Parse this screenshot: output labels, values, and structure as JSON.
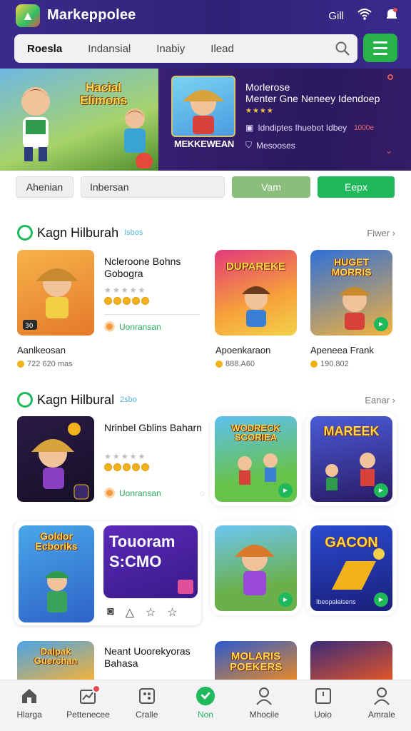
{
  "app": {
    "title": "Markeppolee",
    "logo_icon": "app-logo",
    "accent_color": "#1fb85a",
    "header_color": "#2f2277"
  },
  "status": {
    "signal_label": "Gill",
    "icons": [
      "signal-icon",
      "wifi-icon",
      "notification-icon"
    ]
  },
  "search": {
    "tabs": [
      "Roesla",
      "Indansial",
      "Inabiy",
      "Ilead"
    ],
    "icon": "search-icon",
    "menu_icon": "hamburger-icon"
  },
  "banner": {
    "headline": "Hacial Elimons",
    "art_label": "MEKKEWEAN",
    "title_line1": "Morlerose",
    "title_line2": "Menter Gne Neneey Idendoep",
    "rating": "★★★★",
    "line1": "Idndiptes Ihuebot Idbey",
    "line1_price": "1000e",
    "line2": "Mesooses"
  },
  "filters": [
    "Ahenian",
    "Inbersan",
    "Vam",
    "Eepx"
  ],
  "section1": {
    "title": "Kagn Hilburah",
    "badge": "Isbos",
    "more": "Fiwer",
    "featured": {
      "title": "Ncleroone Bohns Gobogra",
      "stars": "★★★★★",
      "action": "Uonransan",
      "caption": "Aanlkeosan",
      "meta": "722 620 mas"
    },
    "tile1": {
      "label": "DUPAREKE",
      "caption": "Apoenkaraon",
      "meta": "888.A60"
    },
    "tile2": {
      "label": "HUGET MORRIS",
      "caption": "Apeneea Frank",
      "meta": "190.802"
    }
  },
  "section2": {
    "title": "Kagn Hilbural",
    "badge": "2sbo",
    "more": "Eanar",
    "featured": {
      "title": "Nrinbel Gblins Baharn",
      "stars": "★★★★★",
      "action": "Uonransan"
    },
    "tile1": {
      "label": "WODRECK SCORIEA"
    },
    "tile2": {
      "label": "MAREEK"
    },
    "panel_left_label": "Goldor Ecboriks",
    "panel_right_title": "Touoram",
    "panel_right_sub": "S:CMO",
    "tile3": {
      "label": ""
    },
    "tile4": {
      "label": "GACON",
      "meta": "Ibeopalaisens"
    }
  },
  "section3": {
    "tile_label": "Dalpak Guerchan",
    "title": "Neant Uoorekyoras Bahasa",
    "tile2_label": "MOLARIS POEKERS"
  },
  "nav": [
    {
      "label": "Hlarga",
      "icon": "home-icon"
    },
    {
      "label": "Pettenecee",
      "icon": "chart-icon"
    },
    {
      "label": "Cralle",
      "icon": "grid-icon"
    },
    {
      "label": "Non",
      "icon": "play-icon"
    },
    {
      "label": "Mhocile",
      "icon": "person-icon"
    },
    {
      "label": "Uoio",
      "icon": "card-icon"
    },
    {
      "label": "Amrale",
      "icon": "profile-icon"
    }
  ]
}
